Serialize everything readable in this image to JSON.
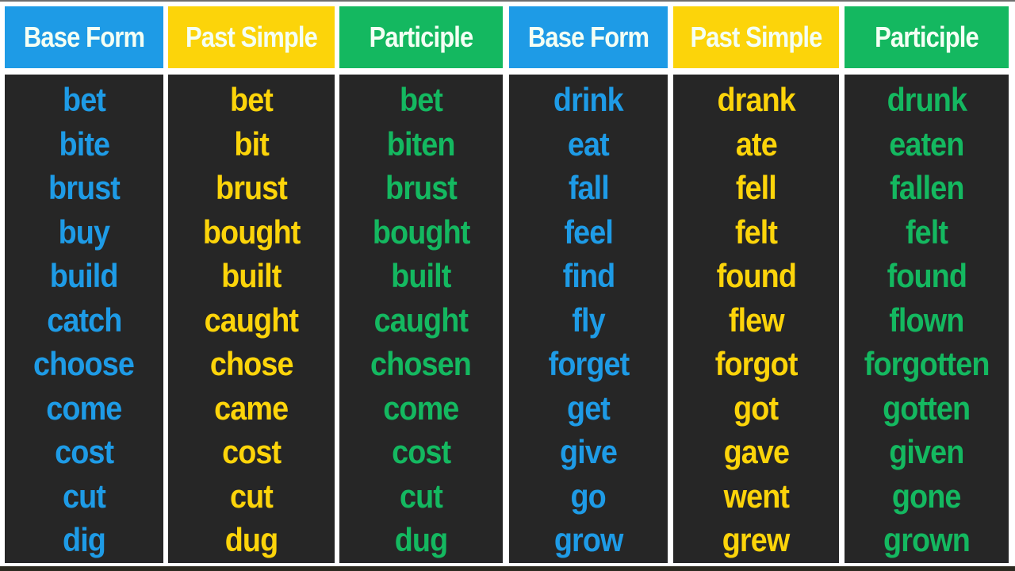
{
  "colors": {
    "base": "#1e9be6",
    "past": "#fcd40a",
    "participle": "#14b860",
    "body_bg": "#262626",
    "header_text": "#f4fff4"
  },
  "tables": [
    {
      "columns": [
        {
          "key": "base",
          "header": "Base Form",
          "words": [
            "bet",
            "bite",
            "brust",
            "buy",
            "build",
            "catch",
            "choose",
            "come",
            "cost",
            "cut",
            "dig"
          ]
        },
        {
          "key": "past",
          "header": "Past Simple",
          "words": [
            "bet",
            "bit",
            "brust",
            "bought",
            "built",
            "caught",
            "chose",
            "came",
            "cost",
            "cut",
            "dug"
          ]
        },
        {
          "key": "participle",
          "header": "Participle",
          "words": [
            "bet",
            "biten",
            "brust",
            "bought",
            "built",
            "caught",
            "chosen",
            "come",
            "cost",
            "cut",
            "dug"
          ]
        }
      ]
    },
    {
      "columns": [
        {
          "key": "base",
          "header": "Base Form",
          "words": [
            "drink",
            "eat",
            "fall",
            "feel",
            "find",
            "fly",
            "forget",
            "get",
            "give",
            "go",
            "grow"
          ]
        },
        {
          "key": "past",
          "header": "Past Simple",
          "words": [
            "drank",
            "ate",
            "fell",
            "felt",
            "found",
            "flew",
            "forgot",
            "got",
            "gave",
            "went",
            "grew"
          ]
        },
        {
          "key": "participle",
          "header": "Participle",
          "words": [
            "drunk",
            "eaten",
            "fallen",
            "felt",
            "found",
            "flown",
            "forgotten",
            "gotten",
            "given",
            "gone",
            "grown"
          ]
        }
      ]
    }
  ]
}
